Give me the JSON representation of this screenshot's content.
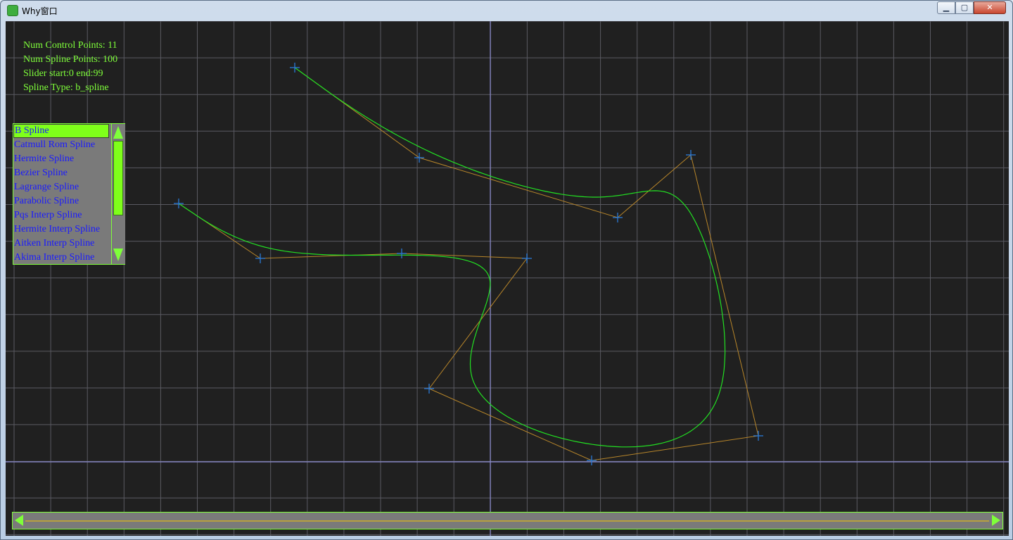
{
  "window": {
    "title": "Why窗口",
    "minimize_label": "▁",
    "maximize_label": "▢",
    "close_label": "✕"
  },
  "info": {
    "num_control_points": "Num Control Points: 11",
    "num_spline_points": "Num Spline Points: 100",
    "slider_range": "Slider start:0 end:99",
    "spline_type": "Spline Type: b_spline"
  },
  "spline_list": {
    "selected_index": 0,
    "items": [
      "B Spline",
      "Catmull Rom Spline",
      "Hermite Spline",
      "Bezier Spline",
      "Lagrange Spline",
      "Parabolic Spline",
      "Pqs Interp Spline",
      "Hermite Interp Spline",
      "Aitken Interp Spline",
      "Akima Interp Spline"
    ]
  },
  "slider": {
    "start": 0,
    "end": 99
  },
  "colors": {
    "background": "#202020",
    "grid": "#5a5a62",
    "axis": "#8a8ad0",
    "control_polygon": "#b8862a",
    "spline": "#22e022",
    "control_marker": "#2a7ad8",
    "ui_accent": "#7fff3a"
  },
  "icons": {
    "app": "app-icon",
    "scroll_up": "arrow-up-icon",
    "scroll_down": "arrow-down-icon",
    "slider_left": "arrow-left-icon",
    "slider_right": "arrow-right-icon"
  }
}
